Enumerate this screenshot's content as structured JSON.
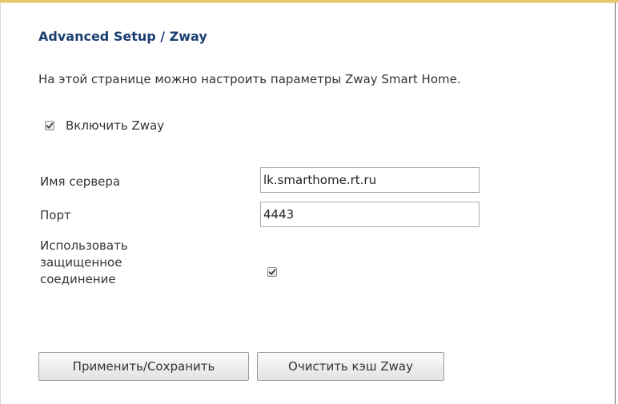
{
  "page": {
    "title": "Advanced Setup / Zway",
    "description": "На этой странице можно настроить параметры Zway Smart Home."
  },
  "enable_zway": {
    "label": "Включить Zway",
    "checked": true
  },
  "fields": {
    "server_name": {
      "label": "Имя сервера",
      "value": "lk.smarthome.rt.ru"
    },
    "port": {
      "label": "Порт",
      "value": "4443"
    },
    "secure_connection": {
      "label": "Использовать защищенное соединение",
      "checked": true
    }
  },
  "buttons": {
    "save_label": "Применить/Сохранить",
    "clear_cache_label": "Очистить кэш Zway"
  },
  "colors": {
    "title": "#1c3f72",
    "text": "#333333",
    "frame_top": "#e6c86a"
  },
  "icons": {
    "checkbox_checked": "checkmark-icon"
  }
}
